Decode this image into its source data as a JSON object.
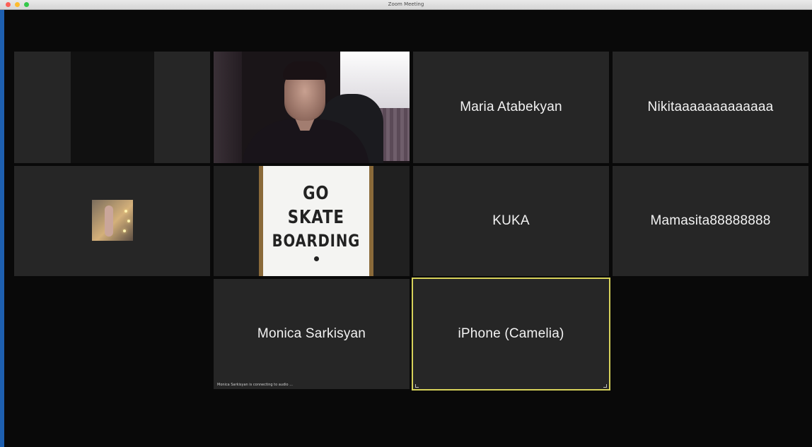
{
  "window": {
    "title": "Zoom Meeting",
    "traffic_lights": {
      "close": "#fc5f57",
      "minimize": "#fdbc2e",
      "zoom": "#34c84a"
    }
  },
  "participants": [
    {
      "id": "video-dark",
      "name": ""
    },
    {
      "id": "video-webcam",
      "name": ""
    },
    {
      "id": "maria",
      "name": "Maria Atabekyan"
    },
    {
      "id": "nikita",
      "name": "Nikitaaaaaaaaaaaaa"
    },
    {
      "id": "photo",
      "name": ""
    },
    {
      "id": "sign",
      "name": "",
      "sign_lines": [
        "GO",
        "SKATE",
        "BOARDING"
      ]
    },
    {
      "id": "kuka",
      "name": "KUKA"
    },
    {
      "id": "mamasita",
      "name": "Mamasita88888888"
    },
    {
      "id": "monica",
      "name": "Monica Sarkisyan",
      "status": "Monica Sarkisyan is connecting to audio ..."
    },
    {
      "id": "camelia",
      "name": "iPhone (Camelia)",
      "active_speaker": true
    }
  ],
  "colors": {
    "tile_bg": "#262626",
    "active_border": "#d7d25a",
    "background": "#090909"
  }
}
